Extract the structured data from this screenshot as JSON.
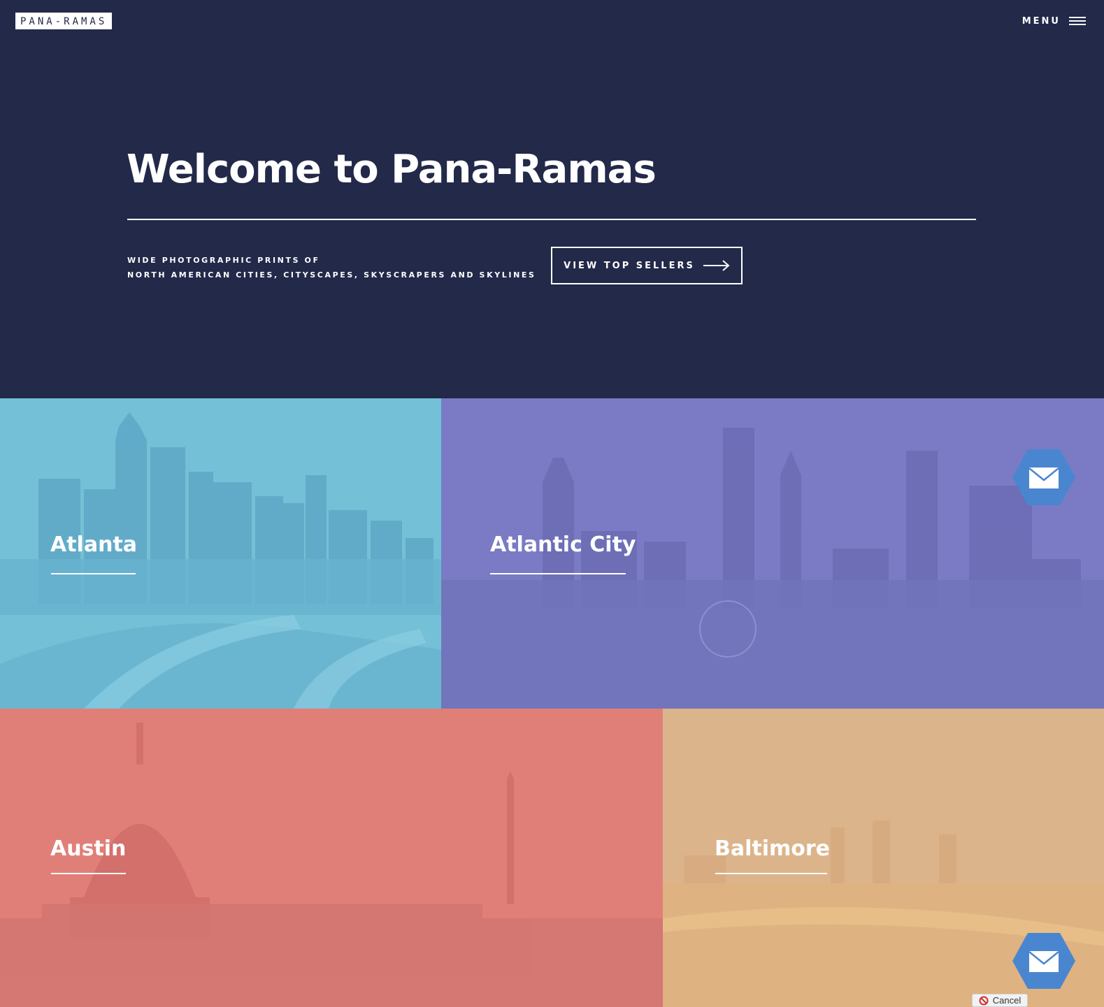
{
  "header": {
    "logo_text": "PANA-RAMAS",
    "menu_label": "MENU",
    "menu_icon": "hamburger-icon"
  },
  "hero": {
    "title": "Welcome to Pana-Ramas",
    "tagline_line1": "WIDE PHOTOGRAPHIC PRINTS OF",
    "tagline_line2": "NORTH AMERICAN CITIES, CITYSCAPES, SKYSCRAPERS AND SKYLINES",
    "cta_label": "VIEW TOP SELLERS",
    "cta_icon": "arrow-right-icon",
    "background_color": "#222949"
  },
  "cities": [
    {
      "name": "Atlanta",
      "overlay_color": "#74c0d6"
    },
    {
      "name": "Atlantic City",
      "overlay_color": "#7a7bc4"
    },
    {
      "name": "Austin",
      "overlay_color": "#e07f78"
    },
    {
      "name": "Baltimore",
      "overlay_color": "#dcb48b"
    }
  ],
  "floating": {
    "mail_icon": "envelope-icon",
    "mail_button_color": "#4a86cf",
    "cancel_label": "Cancel",
    "cancel_icon": "prohibited-icon"
  }
}
